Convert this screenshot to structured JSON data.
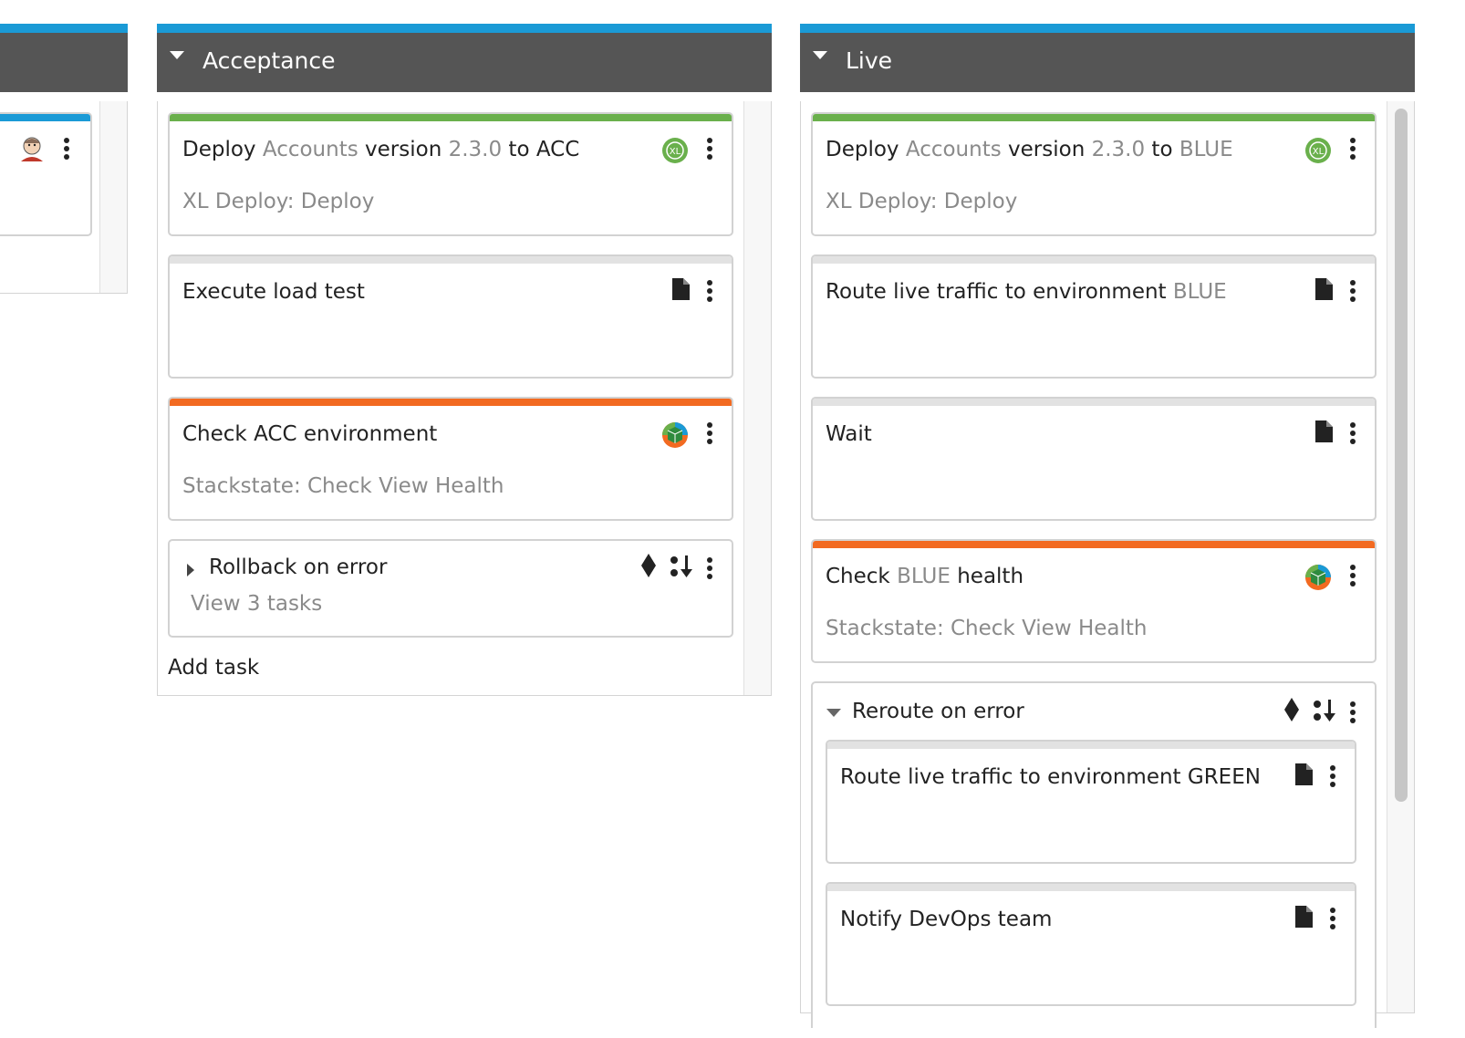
{
  "left_column": {
    "avatar_icon": "jenkins-avatar-icon",
    "accent_color": "#1a9ad6"
  },
  "acceptance": {
    "title": "Acceptance",
    "tasks": [
      {
        "title_parts": [
          "Deploy ",
          "Accounts",
          " version ",
          "2.3.0",
          " to ACC"
        ],
        "subtitle": "XL Deploy: Deploy",
        "status_color": "#6ab04c",
        "icon": "xl-deploy-icon"
      },
      {
        "title": "Execute load test",
        "icon": "document-icon"
      },
      {
        "title": "Check ACC environment",
        "subtitle": "Stackstate: Check View Health",
        "status_color": "#f26a21",
        "icon": "stackstate-icon"
      }
    ],
    "group": {
      "title": "Rollback on error",
      "link": "View 3 tasks",
      "icons": [
        "diamond-icon",
        "sequential-order-icon"
      ]
    },
    "add_task": "Add task"
  },
  "live": {
    "title": "Live",
    "tasks": [
      {
        "title_parts": [
          "Deploy ",
          "Accounts",
          " version ",
          "2.3.0",
          " to ",
          "BLUE"
        ],
        "subtitle": "XL Deploy: Deploy",
        "status_color": "#6ab04c",
        "icon": "xl-deploy-icon"
      },
      {
        "title_parts": [
          "Route live traffic to environment ",
          "BLUE"
        ],
        "icon": "document-icon"
      },
      {
        "title": "Wait",
        "icon": "document-icon"
      },
      {
        "title_parts": [
          "Check ",
          "BLUE",
          " health"
        ],
        "subtitle": "Stackstate: Check View Health",
        "status_color": "#f26a21",
        "icon": "stackstate-icon"
      }
    ],
    "group": {
      "title": "Reroute on error",
      "icons": [
        "diamond-icon",
        "sequential-order-icon"
      ],
      "tasks": [
        {
          "title": "Route live traffic to environment GREEN",
          "icon": "document-icon"
        },
        {
          "title": "Notify DevOps team",
          "icon": "document-icon"
        }
      ]
    }
  }
}
